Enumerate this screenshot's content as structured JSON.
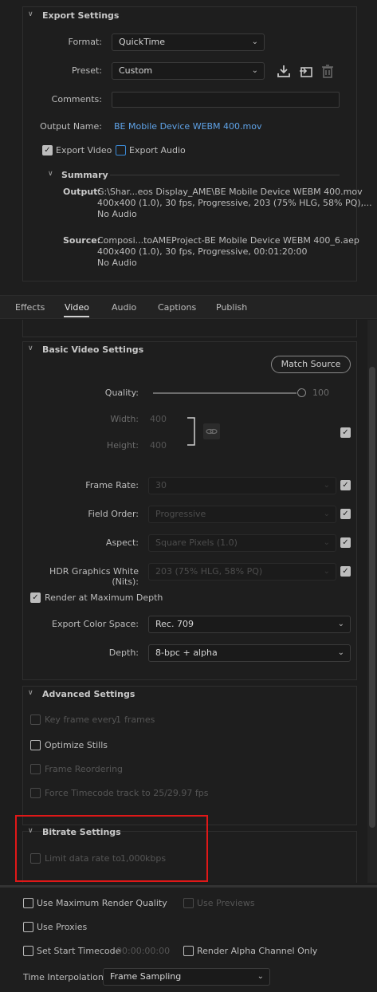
{
  "export_settings": {
    "title": "Export Settings",
    "format_label": "Format:",
    "format_value": "QuickTime",
    "preset_label": "Preset:",
    "preset_value": "Custom",
    "comments_label": "Comments:",
    "comments_value": "",
    "output_name_label": "Output Name:",
    "output_name_value": "BE Mobile Device WEBM 400.mov",
    "export_video_label": "Export Video",
    "export_audio_label": "Export Audio",
    "summary_title": "Summary",
    "output_label": "Output:",
    "output_line1": "G:\\Shar...eos Display_AME\\BE Mobile Device WEBM 400.mov",
    "output_line2": "400x400 (1.0), 30 fps, Progressive, 203 (75% HLG, 58% PQ),...",
    "output_line3": "No Audio",
    "source_label": "Source:",
    "source_line1": "Composi...toAMEProject-BE Mobile Device WEBM 400_6.aep",
    "source_line2": "400x400 (1.0), 30 fps, Progressive, 00:01:20:00",
    "source_line3": "No Audio"
  },
  "tabs": [
    {
      "label": "Effects"
    },
    {
      "label": "Video"
    },
    {
      "label": "Audio"
    },
    {
      "label": "Captions"
    },
    {
      "label": "Publish"
    }
  ],
  "basic_video": {
    "title": "Basic Video Settings",
    "match_source": "Match Source",
    "quality_label": "Quality:",
    "quality_value": "100",
    "quality_level": 1.0,
    "width_label": "Width:",
    "width_value": "400",
    "height_label": "Height:",
    "height_value": "400",
    "frame_rate_label": "Frame Rate:",
    "frame_rate_value": "30",
    "field_order_label": "Field Order:",
    "field_order_value": "Progressive",
    "aspect_label": "Aspect:",
    "aspect_value": "Square Pixels (1.0)",
    "hdr_label": "HDR Graphics White (Nits):",
    "hdr_value": "203 (75% HLG, 58% PQ)",
    "render_max_depth_label": "Render at Maximum Depth",
    "color_space_label": "Export Color Space:",
    "color_space_value": "Rec. 709",
    "depth_label": "Depth:",
    "depth_value": "8-bpc + alpha"
  },
  "advanced": {
    "title": "Advanced Settings",
    "key_frame_label": "Key frame every",
    "key_frame_value": "1",
    "key_frame_unit": "frames",
    "optimize_stills": "Optimize Stills",
    "frame_reordering": "Frame Reordering",
    "force_timecode": "Force Timecode track to 25/29.97 fps"
  },
  "bitrate": {
    "title": "Bitrate Settings",
    "limit_label": "Limit data rate to",
    "limit_value": "1,000",
    "limit_unit": "kbps"
  },
  "bottom": {
    "max_render_quality": "Use Maximum Render Quality",
    "use_previews": "Use Previews",
    "use_proxies": "Use Proxies",
    "set_start_timecode": "Set Start Timecode",
    "start_timecode_value": "00:00:00:00",
    "render_alpha": "Render Alpha Channel Only",
    "time_interp_label": "Time Interpolation:",
    "time_interp_value": "Frame Sampling"
  },
  "colors": {
    "accent_blue": "#3b8ad6",
    "link_blue": "#5fa3e8",
    "highlight_red": "#e01818"
  }
}
